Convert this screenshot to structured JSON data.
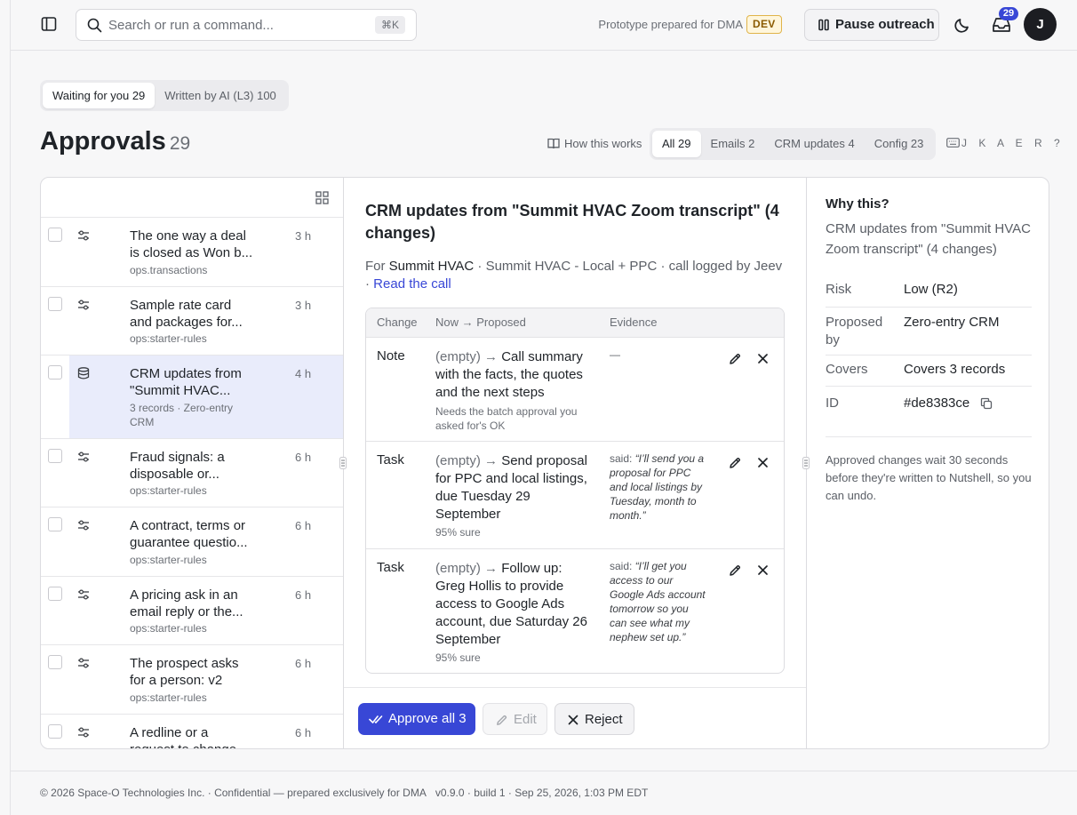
{
  "header": {
    "search_placeholder": "Search or run a command...",
    "search_shortcut": "⌘K",
    "prototype_text": "Prototype prepared for DMA",
    "env_badge": "DEV",
    "pause_label": "Pause outreach",
    "inbox_count": "29",
    "avatar_initial": "J"
  },
  "view_tabs": [
    {
      "label": "Waiting for you 29",
      "active": true
    },
    {
      "label": "Written by AI (L3) 100",
      "active": false
    }
  ],
  "page": {
    "title": "Approvals",
    "count": "29",
    "how_link": "How this works",
    "shortcuts": "J K A E R ?"
  },
  "filters": [
    {
      "label": "All 29",
      "active": true
    },
    {
      "label": "Emails 2",
      "active": false
    },
    {
      "label": "CRM updates 4",
      "active": false
    },
    {
      "label": "Config 23",
      "active": false
    }
  ],
  "list_items": [
    {
      "title": "The one way a deal is closed as Won b...",
      "subtitle": "ops.transactions",
      "time": "3 h",
      "icon": "sliders-icon",
      "selected": false
    },
    {
      "title": "Sample rate card and packages for...",
      "subtitle": "ops:starter-rules",
      "time": "3 h",
      "icon": "sliders-icon",
      "selected": false
    },
    {
      "title": "CRM updates from \"Summit HVAC...",
      "subtitle": "3 records · Zero-entry CRM",
      "time": "4 h",
      "icon": "database-icon",
      "selected": true
    },
    {
      "title": "Fraud signals: a disposable or...",
      "subtitle": "ops:starter-rules",
      "time": "6 h",
      "icon": "sliders-icon",
      "selected": false
    },
    {
      "title": "A contract, terms or guarantee questio...",
      "subtitle": "ops:starter-rules",
      "time": "6 h",
      "icon": "sliders-icon",
      "selected": false
    },
    {
      "title": "A pricing ask in an email reply or the...",
      "subtitle": "ops:starter-rules",
      "time": "6 h",
      "icon": "sliders-icon",
      "selected": false
    },
    {
      "title": "The prospect asks for a person: v2",
      "subtitle": "ops:starter-rules",
      "time": "6 h",
      "icon": "sliders-icon",
      "selected": false
    },
    {
      "title": "A redline or a request to change...",
      "subtitle": "",
      "time": "6 h",
      "icon": "sliders-icon",
      "selected": false
    }
  ],
  "detail": {
    "title": "CRM updates from \"Summit HVAC Zoom transcript\" (4 changes)",
    "meta_prefix": "For ",
    "meta_company": "Summit HVAC",
    "meta_rest": " · Summit HVAC - Local + PPC · call logged by Jeev · ",
    "meta_link": "Read the call",
    "columns": {
      "change": "Change",
      "now_proposed": "Now → Proposed",
      "evidence": "Evidence"
    },
    "changes": [
      {
        "type": "Note",
        "old": "(empty)",
        "arrow": "→",
        "new": "Call summary with the facts, the quotes and the next steps",
        "note": "Needs the batch approval you asked for's OK",
        "evidence_prefix": "—",
        "evidence_quote": ""
      },
      {
        "type": "Task",
        "old": "(empty)",
        "arrow": "→",
        "new": "Send proposal for PPC and local listings, due Tuesday 29 September",
        "note": "95% sure",
        "evidence_prefix": "said: ",
        "evidence_quote": "“I’ll send you a proposal for PPC and local listings by Tuesday, month to month.”"
      },
      {
        "type": "Task",
        "old": "(empty)",
        "arrow": "→",
        "new": "Follow up: Greg Hollis to provide access to Google Ads account, due Saturday 26 September",
        "note": "95% sure",
        "evidence_prefix": "said: ",
        "evidence_quote": "“I’ll get you access to our Google Ads account tomorrow so you can see what my nephew set up.”"
      }
    ],
    "approve_label": "Approve all 3",
    "edit_label": "Edit",
    "reject_label": "Reject"
  },
  "why": {
    "title": "Why this?",
    "description": "CRM updates from \"Summit HVAC Zoom transcript\" (4 changes)",
    "risk_label": "Risk",
    "risk_value": "Low (R2)",
    "proposed_label": "Proposed by",
    "proposed_value": "Zero-entry CRM",
    "covers_label": "Covers",
    "covers_value": "Covers 3 records",
    "id_label": "ID",
    "id_value": "#de8383ce",
    "note": "Approved changes wait 30 seconds before they're written to Nutshell, so you can undo."
  },
  "footer": {
    "copyright": "© 2026 Space-O Technologies Inc. · Confidential — prepared exclusively for DMA",
    "version": "v0.9.0 · build 1 · Sep 25, 2026, 1:03 PM EDT"
  },
  "colors": {
    "accent": "#3847d6",
    "selected_row": "#e9ecfb",
    "dev_badge": "#fff6dc"
  }
}
